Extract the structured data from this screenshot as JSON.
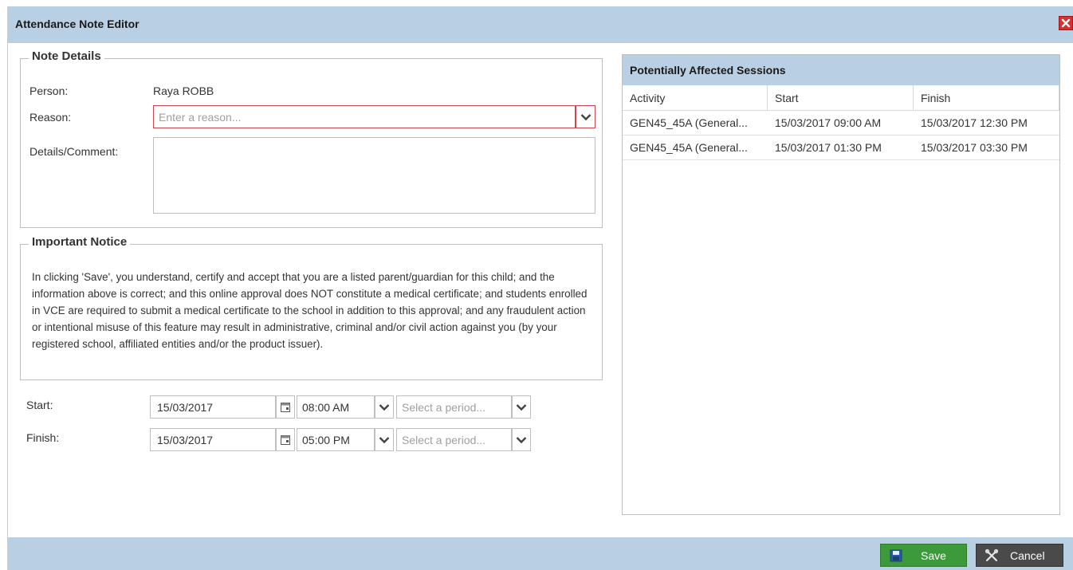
{
  "window": {
    "title": "Attendance Note Editor",
    "close_icon": "close-icon"
  },
  "note_details": {
    "legend": "Note Details",
    "person_label": "Person:",
    "person_value": "Raya ROBB",
    "reason_label": "Reason:",
    "reason_placeholder": "Enter a reason...",
    "comment_label": "Details/Comment:"
  },
  "notice": {
    "legend": "Important Notice",
    "text": "In clicking 'Save', you understand, certify and accept that you are a listed parent/guardian for this child; and the information above is correct; and this online approval does NOT constitute a medical certificate; and students enrolled in VCE are required to submit a medical certificate to the school in addition to this approval; and any fraudulent action or intentional misuse of this feature may result in administrative, criminal and/or civil action against you (by your registered school, affiliated entities and/or the product issuer)."
  },
  "schedule": {
    "start_label": "Start:",
    "start_date": "15/03/2017",
    "start_time": "08:00 AM",
    "start_period_placeholder": "Select a period...",
    "finish_label": "Finish:",
    "finish_date": "15/03/2017",
    "finish_time": "05:00 PM",
    "finish_period_placeholder": "Select a period..."
  },
  "sessions": {
    "title": "Potentially Affected Sessions",
    "columns": [
      "Activity",
      "Start",
      "Finish"
    ],
    "rows": [
      [
        "GEN45_45A (General...",
        "15/03/2017 09:00 AM",
        "15/03/2017 12:30 PM"
      ],
      [
        "GEN45_45A (General...",
        "15/03/2017 01:30 PM",
        "15/03/2017 03:30 PM"
      ]
    ]
  },
  "footer": {
    "save_label": "Save",
    "cancel_label": "Cancel"
  },
  "colors": {
    "header_bg": "#b9cfe3",
    "save_green": "#3d9a3b",
    "cancel_dark": "#4a4a4a",
    "close_red": "#d63030",
    "invalid_border": "#c9474a"
  }
}
